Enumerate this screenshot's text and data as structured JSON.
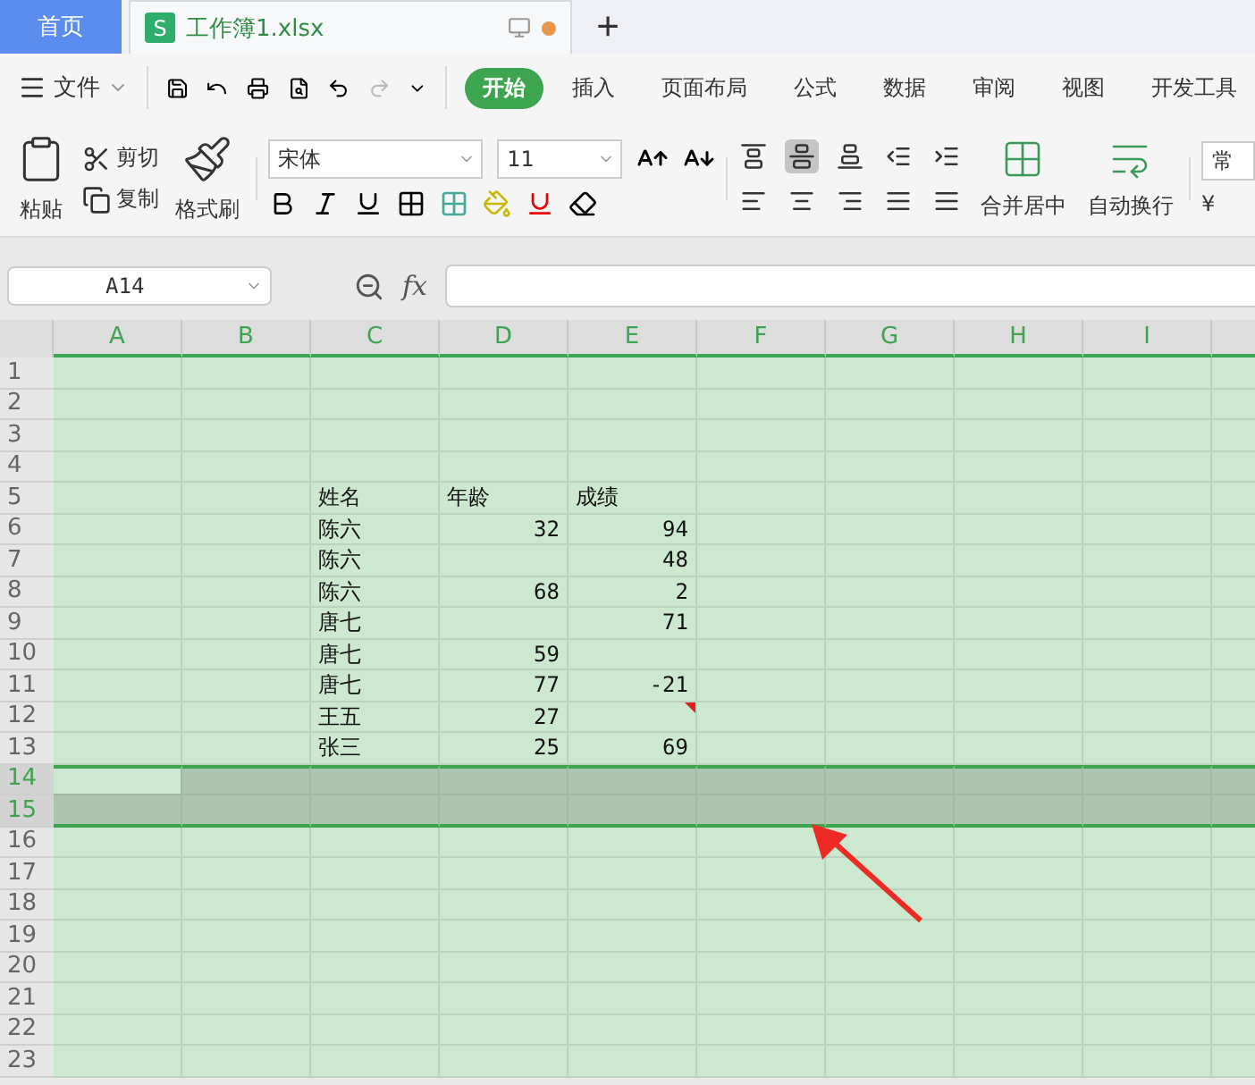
{
  "tabs": [
    {
      "label": "首页",
      "kind": "home",
      "selected": false
    },
    {
      "label": "工作簿1.xlsx",
      "kind": "document",
      "selected": true,
      "badge": "S",
      "unsaved": true
    }
  ],
  "new_tab": "+",
  "menu": {
    "file": "文件",
    "items": [
      {
        "label": "开始",
        "selected": true
      },
      {
        "label": "插入",
        "selected": false
      },
      {
        "label": "页面布局",
        "selected": false
      },
      {
        "label": "公式",
        "selected": false
      },
      {
        "label": "数据",
        "selected": false
      },
      {
        "label": "审阅",
        "selected": false
      },
      {
        "label": "视图",
        "selected": false
      },
      {
        "label": "开发工具",
        "selected": false
      }
    ]
  },
  "ribbon": {
    "paste": "粘贴",
    "cut": "剪切",
    "copy": "复制",
    "format_painter": "格式刷",
    "font": "宋体",
    "size": "11",
    "merge": "合并居中",
    "wrap": "自动换行",
    "number_format": "常",
    "currency": "¥"
  },
  "formula_bar": {
    "name_box": "A14",
    "fx": "fx"
  },
  "grid": {
    "columns": [
      "A",
      "B",
      "C",
      "D",
      "E",
      "F",
      "G",
      "H",
      "I"
    ],
    "rows": [
      {
        "label": "1",
        "selected": false,
        "cells": {}
      },
      {
        "label": "2",
        "selected": false,
        "cells": {}
      },
      {
        "label": "3",
        "selected": false,
        "cells": {}
      },
      {
        "label": "4",
        "selected": false,
        "cells": {}
      },
      {
        "label": "5",
        "selected": false,
        "cells": {
          "C": {
            "text": "姓名"
          },
          "D": {
            "text": "年龄"
          },
          "E": {
            "text": "成绩"
          }
        }
      },
      {
        "label": "6",
        "selected": false,
        "cells": {
          "C": {
            "text": "陈六"
          },
          "D": {
            "text": "32",
            "kind": "number"
          },
          "E": {
            "text": "94",
            "kind": "number"
          }
        }
      },
      {
        "label": "7",
        "selected": false,
        "cells": {
          "C": {
            "text": "陈六"
          },
          "E": {
            "text": "48",
            "kind": "number"
          }
        }
      },
      {
        "label": "8",
        "selected": false,
        "cells": {
          "C": {
            "text": "陈六"
          },
          "D": {
            "text": "68",
            "kind": "number"
          },
          "E": {
            "text": "2",
            "kind": "number"
          }
        }
      },
      {
        "label": "9",
        "selected": false,
        "cells": {
          "C": {
            "text": "唐七"
          },
          "E": {
            "text": "71",
            "kind": "number"
          }
        }
      },
      {
        "label": "10",
        "selected": false,
        "cells": {
          "C": {
            "text": "唐七"
          },
          "D": {
            "text": "59",
            "kind": "number"
          }
        }
      },
      {
        "label": "11",
        "selected": false,
        "cells": {
          "C": {
            "text": "唐七"
          },
          "D": {
            "text": "77",
            "kind": "number"
          },
          "E": {
            "text": "-21",
            "kind": "number"
          }
        }
      },
      {
        "label": "12",
        "selected": false,
        "cells": {
          "C": {
            "text": "王五"
          },
          "D": {
            "text": "27",
            "kind": "number"
          },
          "E": {
            "comment": true
          }
        }
      },
      {
        "label": "13",
        "selected": false,
        "cells": {
          "C": {
            "text": "张三"
          },
          "D": {
            "text": "25",
            "kind": "number"
          },
          "E": {
            "text": "69",
            "kind": "number"
          }
        }
      },
      {
        "label": "14",
        "selected": true,
        "cells": {
          "A": {
            "active": true
          }
        }
      },
      {
        "label": "15",
        "selected": true,
        "cells": {}
      },
      {
        "label": "16",
        "selected": false,
        "cells": {}
      },
      {
        "label": "17",
        "selected": false,
        "cells": {}
      },
      {
        "label": "18",
        "selected": false,
        "cells": {}
      },
      {
        "label": "19",
        "selected": false,
        "cells": {}
      },
      {
        "label": "20",
        "selected": false,
        "cells": {}
      },
      {
        "label": "21",
        "selected": false,
        "cells": {}
      },
      {
        "label": "22",
        "selected": false,
        "cells": {}
      },
      {
        "label": "23",
        "selected": false,
        "cells": {}
      }
    ]
  }
}
